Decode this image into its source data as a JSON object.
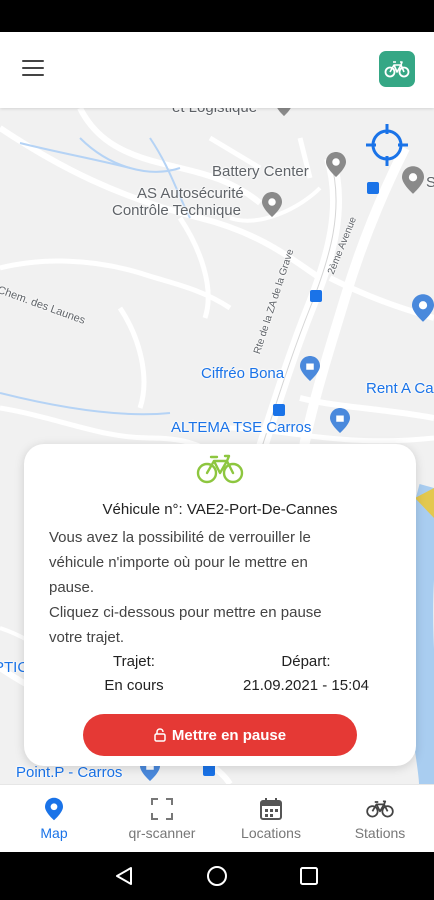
{
  "header": {
    "menu_icon": "hamburger-menu-icon",
    "logo_icon": "bike-logo-icon"
  },
  "colors": {
    "accent_green": "#8dc63f",
    "logo_bg": "#35a785",
    "pause_red": "#e53935",
    "nav_active": "#1a73e8"
  },
  "map": {
    "labels": {
      "logistique": "et Logistique",
      "battery": "Battery Center",
      "autosecurite_1": "AS Autosécurité",
      "autosecurite_2": "Contrôle Technique",
      "chem_launes": "Chem. des Launes",
      "zone_grave": "Rte de la ZA de la Grave",
      "avenue_2": "2ème Avenue",
      "ciffreo": "Ciffréo Bona",
      "rent": "Rent A Ca",
      "altema": "ALTEMA TSE Carros",
      "optic": "PTIC",
      "pointp": "Point.P - Carros",
      "s_edge": "S"
    },
    "location_icon": "my-location-crosshair-icon"
  },
  "card": {
    "bike_icon": "bicycle-icon",
    "vehicle_line": "Véhicule n°: VAE2-Port-De-Cannes",
    "message_line1": "Vous avez la possibilité de verrouiller le",
    "message_line2": "véhicule n'importe où pour le mettre en",
    "message_line3": "pause.",
    "message_line4": "Cliquez ci-dessous pour mettre en pause",
    "message_line5": "votre trajet.",
    "trip_label": "Trajet:",
    "trip_value": "En cours",
    "departure_label": "Départ:",
    "departure_value": "21.09.2021 - 15:04",
    "pause_button": "Mettre en pause",
    "pause_icon": "unlock-icon"
  },
  "bottom_nav": {
    "items": [
      {
        "label": "Map",
        "icon": "map-pin-icon",
        "active": true
      },
      {
        "label": "qr-scanner",
        "icon": "scan-frame-icon",
        "active": false
      },
      {
        "label": "Locations",
        "icon": "calendar-icon",
        "active": false
      },
      {
        "label": "Stations",
        "icon": "bicycle-icon",
        "active": false
      }
    ]
  },
  "system_nav": {
    "back_icon": "back-triangle-icon",
    "home_icon": "home-circle-icon",
    "recents_icon": "recents-square-icon"
  }
}
